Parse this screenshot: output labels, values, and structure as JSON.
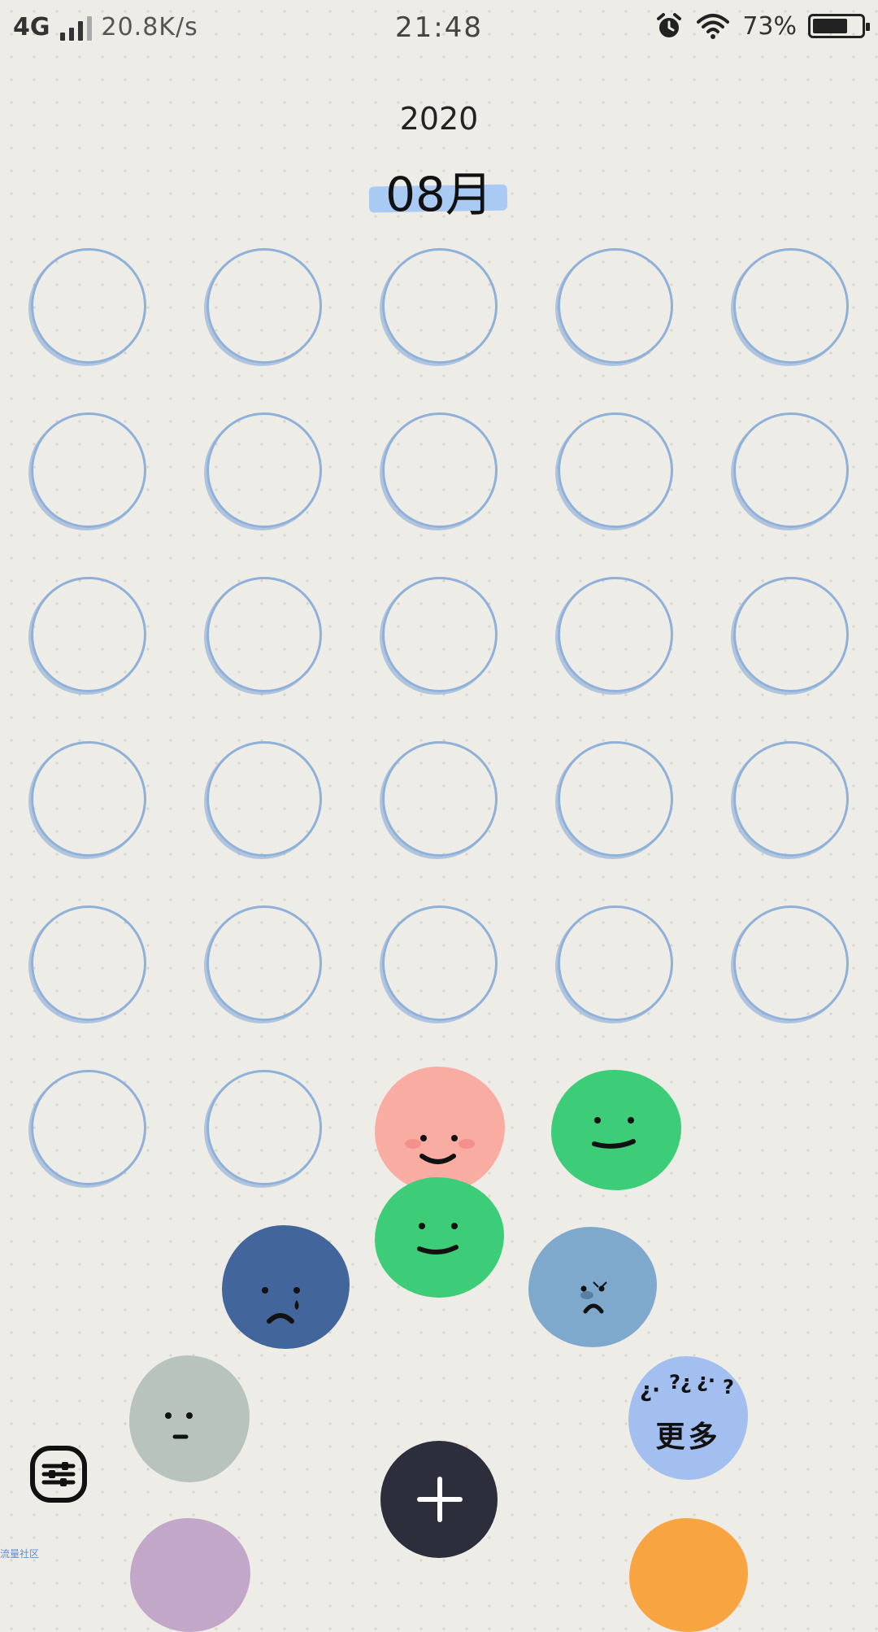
{
  "status_bar": {
    "network": "4G",
    "speed": "20.8K/s",
    "time": "21:48",
    "battery": "73%",
    "battery_level": 0.73
  },
  "header": {
    "year": "2020",
    "month": "08月"
  },
  "calendar": {
    "empty_days": 27,
    "circle_color": "#8fb0d9"
  },
  "moods": [
    {
      "name": "happy-blush",
      "color": "#f9aca2"
    },
    {
      "name": "content-green",
      "color": "#3dcd78"
    },
    {
      "name": "smile-green",
      "color": "#3dcd78"
    },
    {
      "name": "sad-tear",
      "color": "#42659b"
    },
    {
      "name": "worried",
      "color": "#7ea8cc"
    },
    {
      "name": "neutral",
      "color": "#b8c3be"
    },
    {
      "name": "more",
      "color": "#a3bff0",
      "label": "更多",
      "symbols": "¿·?¿¿·?"
    },
    {
      "name": "purple",
      "color": "#c3a7c9"
    },
    {
      "name": "orange",
      "color": "#f8a441"
    }
  ],
  "icons": {
    "settings": "sliders-icon",
    "add": "plus-icon"
  },
  "watermark": "流量社区"
}
